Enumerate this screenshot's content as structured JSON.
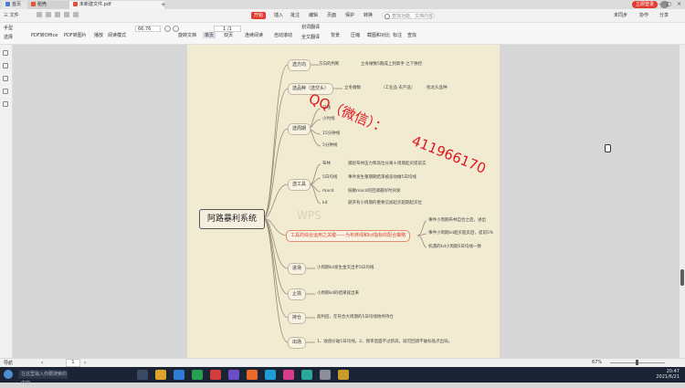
{
  "tabs": [
    {
      "label": "首页",
      "color": "#4d7ed6"
    },
    {
      "label": "稻壳",
      "color": "#e8562a"
    },
    {
      "label": "未新建文件.pdf",
      "color": "#e84c3d"
    }
  ],
  "tab_add": "+",
  "account": {
    "login_label": "立即登录"
  },
  "window_controls": "– ▢ ×",
  "menubar": {
    "file_label": "三 文件",
    "menu_items": [
      {
        "label": "开始",
        "active": true
      },
      {
        "label": "插入"
      },
      {
        "label": "批注"
      },
      {
        "label": "编辑"
      },
      {
        "label": "页面"
      },
      {
        "label": "保护"
      },
      {
        "label": "转换"
      }
    ],
    "search_placeholder": "查找功能、文档内容",
    "right_items": [
      "未同步",
      "协作",
      "分享"
    ]
  },
  "toolbar": {
    "zoom_value": "66.76",
    "page_value": "1 /1",
    "buttons": [
      {
        "label": "手型"
      },
      {
        "label": "选择"
      },
      {
        "label": "PDF转Office"
      },
      {
        "label": "PDF转图片"
      },
      {
        "label": "播放"
      },
      {
        "label": "阅读模式"
      },
      {
        "label": "旋转文档"
      },
      {
        "label": "单页"
      },
      {
        "label": "双页"
      },
      {
        "label": "连续阅读"
      },
      {
        "label": "自动滚动"
      },
      {
        "label": "划词翻译"
      },
      {
        "label": "全文翻译"
      },
      {
        "label": "背景"
      },
      {
        "label": "压缩"
      },
      {
        "label": "截图和对比"
      },
      {
        "label": "标注"
      },
      {
        "label": "查找"
      }
    ]
  },
  "mindmap": {
    "root": "阿路暴利系统",
    "branches": [
      {
        "label": "选方向",
        "leaves": [
          "方向的判断",
          "立冬做数5期成上到新手 之下致控"
        ]
      },
      {
        "label": "选品种（选交头）",
        "leaves": [
          "立冬做数",
          "（工业品 农产品）",
          "找龙头品种"
        ]
      },
      {
        "label": "选周期",
        "leaves": [
          "日线",
          "小时线",
          "15分钟线",
          "5分钟线"
        ]
      },
      {
        "label": "选工具",
        "leaves": [
          "布林",
          "捕捉布林压力和高位分离十周期起买提前实",
          "5日均线",
          "事件发生重期期结束被波动做5日均线",
          "macd",
          "抵赖macd的回调最好时间发",
          "kd",
          "避开有小周期的重要信加起买超期起买位"
        ]
      },
      {
        "label": "工具的综合运用之关键——为布林线和kd指标的配合策略",
        "leaves": [
          "事件小周期布林自合之后，进出",
          "事件小周期kd超买超卖后，提前5%",
          "机遇的kd小周期5日均线一致"
        ]
      },
      {
        "label": "进场",
        "leaves": [
          "小周期kd发生金叉出手5日均线"
        ]
      },
      {
        "label": "止损",
        "leaves": [
          "小周期kd的结果就出来"
        ]
      },
      {
        "label": "持仓",
        "leaves": [
          "盈利后，在符合大周期的5日均线始终持仓"
        ]
      },
      {
        "label": "出场",
        "leaves": [
          "1、收盘价破5日均线。2、频率后面不过新高，就可回调不破标低点出局。"
        ]
      }
    ]
  },
  "watermark": {
    "line1": "QQ（微信）：",
    "number": "411966170",
    "wps": "WPS"
  },
  "statusbar": {
    "nav_label": "导航",
    "page_indicator": "1",
    "zoom_percent": "67%"
  },
  "taskbar": {
    "search_placeholder": "在这里输入你要搜索的内容",
    "time": "20:47",
    "date": "2021/6/21"
  }
}
